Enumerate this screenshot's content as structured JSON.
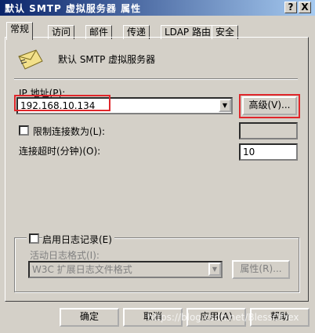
{
  "window": {
    "title": "默认 SMTP 虚拟服务器 属性",
    "help_btn": "?",
    "close_btn": "X"
  },
  "tabs": [
    {
      "label": "常规"
    },
    {
      "label": "访问"
    },
    {
      "label": "邮件"
    },
    {
      "label": "传递"
    },
    {
      "label": "LDAP 路由"
    },
    {
      "label": "安全"
    }
  ],
  "general": {
    "server_name": "默认 SMTP 虚拟服务器",
    "ip_label": "IP 地址(P):",
    "ip_value": "192.168.10.134",
    "advanced_btn": "高级(V)...",
    "limit_connections_label": "限制连接数为(L):",
    "limit_connections_value": "",
    "timeout_label": "连接超时(分钟)(O):",
    "timeout_value": "10",
    "logging": {
      "enable_label": "启用日志记录(E)",
      "format_label": "活动日志格式(I):",
      "format_value": "W3C 扩展日志文件格式",
      "properties_btn": "属性(R)..."
    }
  },
  "footer": {
    "ok": "确定",
    "cancel": "取消",
    "apply": "应用(A)",
    "help": "帮助"
  },
  "watermark": "https://blog.csdn.net/BlessOfYex",
  "highlight_color": "#e0262b"
}
